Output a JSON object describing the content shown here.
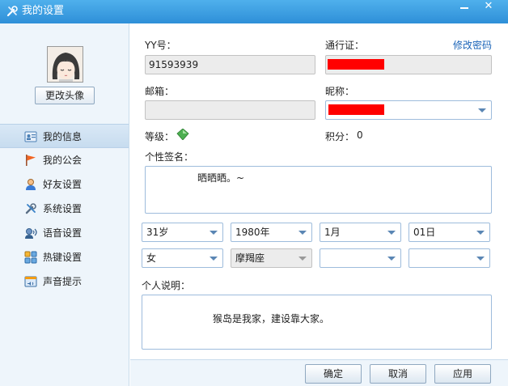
{
  "window": {
    "title": "我的设置",
    "minimize_glyph": "",
    "close_glyph": "✕"
  },
  "sidebar": {
    "change_avatar_label": "更改头像",
    "items": [
      {
        "label": "我的信息",
        "icon": "id-card-icon",
        "active": true
      },
      {
        "label": "我的公会",
        "icon": "flag-icon"
      },
      {
        "label": "好友设置",
        "icon": "user-icon"
      },
      {
        "label": "系统设置",
        "icon": "tools-icon"
      },
      {
        "label": "语音设置",
        "icon": "voice-icon"
      },
      {
        "label": "热键设置",
        "icon": "hotkey-icon"
      },
      {
        "label": "声音提示",
        "icon": "sound-icon"
      }
    ]
  },
  "profile": {
    "yy_label": "YY号：",
    "yy_value": "91593939",
    "passport_label": "通行证：",
    "change_password_link": "修改密码",
    "email_label": "邮箱：",
    "email_value": "",
    "nickname_label": "昵称：",
    "level_label": "等级：",
    "points_label": "积分：",
    "points_value": "0",
    "signature_label": "个性签名：",
    "signature_value": "晒晒晒。~",
    "age": "31岁",
    "birth_year": "1980年",
    "birth_month": "1月",
    "birth_day": "01日",
    "gender": "女",
    "zodiac": "摩羯座",
    "province": "",
    "city": "",
    "intro_label": "个人说明：",
    "intro_value": "猴岛是我家，建设靠大家。"
  },
  "buttons": {
    "ok": "确定",
    "cancel": "取消",
    "apply": "应用"
  },
  "colors": {
    "titlebar": "#2e8fd8",
    "link": "#1a64b8",
    "redaction": "#ff0000",
    "level_diamond": "#4caf50"
  }
}
